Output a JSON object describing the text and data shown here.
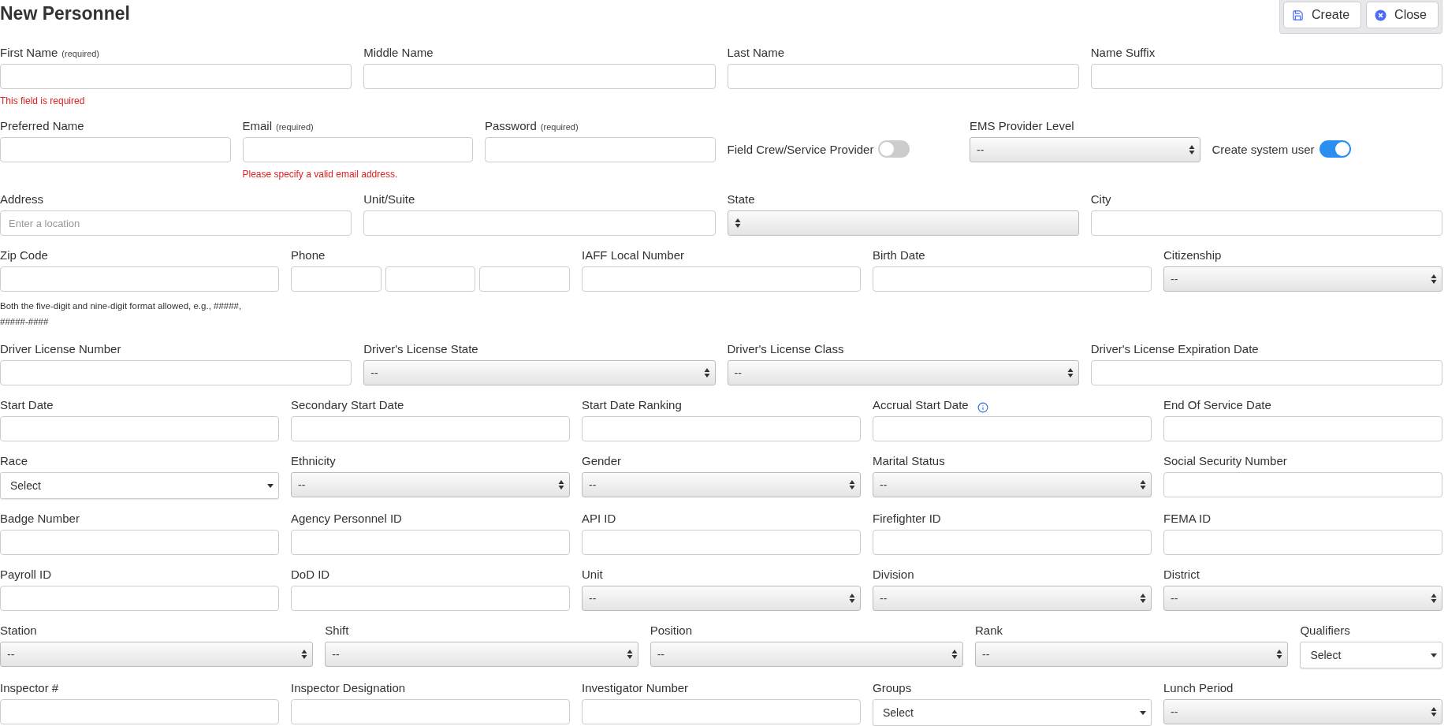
{
  "title": "New Personnel",
  "actions": [
    {
      "kind": "save",
      "label": "Create"
    },
    {
      "kind": "close",
      "label": "Close"
    }
  ],
  "rows": [
    {
      "fields": [
        {
          "kind": "text",
          "label": "First Name",
          "note": "(required)",
          "error": "This field is required"
        },
        {
          "kind": "text",
          "label": "Middle Name"
        },
        {
          "kind": "text",
          "label": "Last Name"
        },
        {
          "kind": "text",
          "label": "Name Suffix"
        }
      ]
    },
    {
      "fields": [
        {
          "kind": "text",
          "label": "Preferred Name"
        },
        {
          "kind": "text",
          "label": "Email",
          "note": "(required)",
          "error": "Please specify a valid email address."
        },
        {
          "kind": "text",
          "label": "Password",
          "note": "(required)"
        },
        {
          "kind": "toggle",
          "label": "Field Crew/Service Provider",
          "on": false
        },
        {
          "kind": "select",
          "label": "EMS Provider Level",
          "value": "--"
        },
        {
          "kind": "toggle",
          "label": "Create system user",
          "on": true
        }
      ]
    },
    {
      "fields": [
        {
          "kind": "text",
          "label": "Address",
          "placeholder": "Enter a location"
        },
        {
          "kind": "text",
          "label": "Unit/Suite"
        },
        {
          "kind": "select",
          "label": "State"
        },
        {
          "kind": "text",
          "label": "City"
        }
      ]
    },
    {
      "fields": [
        {
          "kind": "text",
          "label": "Zip Code",
          "help": "Both the five-digit and nine-digit format allowed, e.g., #####, #####-####"
        },
        {
          "kind": "phone",
          "label": "Phone"
        },
        {
          "kind": "text",
          "label": "IAFF Local Number"
        },
        {
          "kind": "text",
          "label": "Birth Date"
        },
        {
          "kind": "select",
          "label": "Citizenship",
          "value": "--"
        }
      ]
    },
    {
      "fields": [
        {
          "kind": "text",
          "label": "Driver License Number"
        },
        {
          "kind": "select",
          "label": "Driver's License State",
          "value": "--"
        },
        {
          "kind": "select",
          "label": "Driver's License Class",
          "value": "--"
        },
        {
          "kind": "text",
          "label": "Driver's License Expiration Date"
        }
      ]
    },
    {
      "fields": [
        {
          "kind": "text",
          "label": "Start Date"
        },
        {
          "kind": "text",
          "label": "Secondary Start Date"
        },
        {
          "kind": "text",
          "label": "Start Date Ranking"
        },
        {
          "kind": "text",
          "label": "Accrual Start Date",
          "info": true
        },
        {
          "kind": "text",
          "label": "End Of Service Date"
        }
      ]
    },
    {
      "fields": [
        {
          "kind": "dropdown",
          "label": "Race",
          "value": "Select"
        },
        {
          "kind": "select",
          "label": "Ethnicity",
          "value": "--"
        },
        {
          "kind": "select",
          "label": "Gender",
          "value": "--"
        },
        {
          "kind": "select",
          "label": "Marital Status",
          "value": "--"
        },
        {
          "kind": "text",
          "label": "Social Security Number"
        }
      ]
    },
    {
      "fields": [
        {
          "kind": "text",
          "label": "Badge Number"
        },
        {
          "kind": "text",
          "label": "Agency Personnel ID"
        },
        {
          "kind": "text",
          "label": "API ID"
        },
        {
          "kind": "text",
          "label": "Firefighter ID"
        },
        {
          "kind": "text",
          "label": "FEMA ID"
        }
      ]
    },
    {
      "fields": [
        {
          "kind": "text",
          "label": "Payroll ID"
        },
        {
          "kind": "text",
          "label": "DoD ID"
        },
        {
          "kind": "select",
          "label": "Unit",
          "value": "--"
        },
        {
          "kind": "select",
          "label": "Division",
          "value": "--"
        },
        {
          "kind": "select",
          "label": "District",
          "value": "--"
        }
      ]
    },
    {
      "fields": [
        {
          "kind": "select",
          "label": "Station",
          "value": "--"
        },
        {
          "kind": "select",
          "label": "Shift",
          "value": "--"
        },
        {
          "kind": "select",
          "label": "Position",
          "value": "--"
        },
        {
          "kind": "select",
          "label": "Rank",
          "value": "--"
        },
        {
          "kind": "dropdown",
          "label": "Qualifiers",
          "value": "Select"
        }
      ]
    },
    {
      "fields": [
        {
          "kind": "text",
          "label": "Inspector #"
        },
        {
          "kind": "text",
          "label": "Inspector Designation"
        },
        {
          "kind": "text",
          "label": "Investigator Number"
        },
        {
          "kind": "dropdown",
          "label": "Groups",
          "value": "Select"
        },
        {
          "kind": "select",
          "label": "Lunch Period",
          "value": "--"
        }
      ]
    }
  ]
}
